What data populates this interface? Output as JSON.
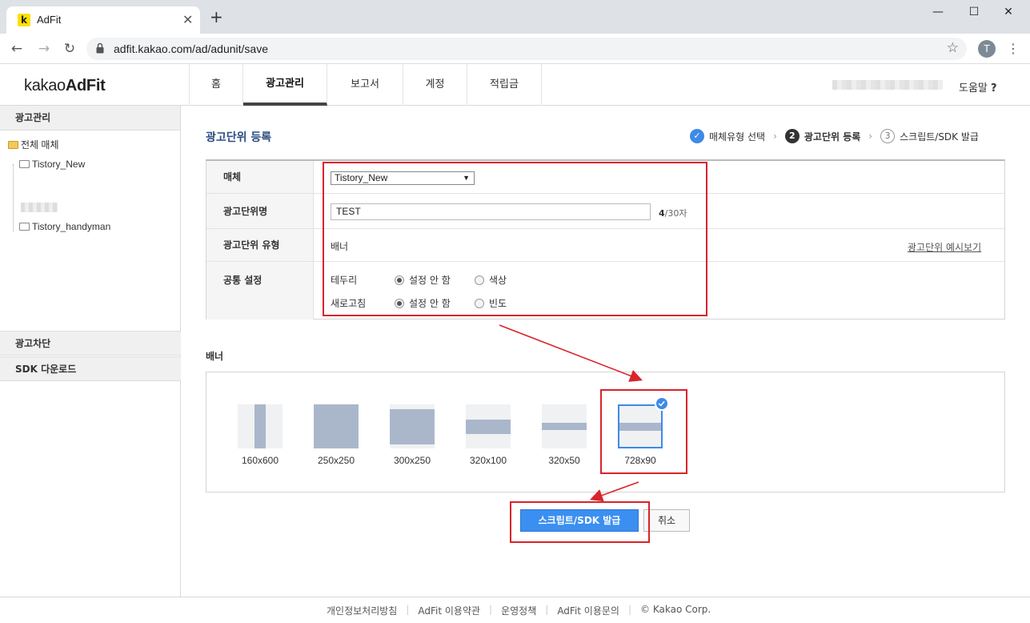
{
  "browser": {
    "tab_title": "AdFit",
    "favicon_letter": "k",
    "url": "adfit.kakao.com/ad/adunit/save",
    "profile_initial": "T",
    "icons": [
      "close-icon",
      "plus-icon",
      "back-icon",
      "forward-icon",
      "reload-icon",
      "lock-icon",
      "star-icon",
      "menu-icon",
      "minimize-icon",
      "maximize-icon"
    ]
  },
  "header": {
    "logo_light": "kakao",
    "logo_bold": "AdFit",
    "nav": [
      {
        "label": "홈"
      },
      {
        "label": "광고관리",
        "active": true
      },
      {
        "label": "보고서"
      },
      {
        "label": "계정"
      },
      {
        "label": "적립금"
      }
    ],
    "help_label": "도움말",
    "help_mark": "?"
  },
  "sidebar": {
    "title": "광고관리",
    "tree_root": "전체 매체",
    "tree_items": [
      "Tistory_New",
      "Tistory_handyman"
    ],
    "sections": [
      "광고차단",
      "SDK 다운로드"
    ]
  },
  "main": {
    "page_title": "광고단위 등록",
    "steps": [
      {
        "num": "✓",
        "label": "매체유형 선택",
        "state": "done"
      },
      {
        "num": "2",
        "label": "광고단위 등록",
        "state": "current"
      },
      {
        "num": "3",
        "label": "스크립트/SDK 발급",
        "state": "next"
      }
    ],
    "form": {
      "media_label": "매체",
      "media_value": "Tistory_New",
      "name_label": "광고단위명",
      "name_value": "TEST",
      "name_count": "4",
      "name_max": "/30자",
      "type_label": "광고단위 유형",
      "type_value": "배너",
      "preview_link": "광고단위 예시보기",
      "common_label": "공통 설정",
      "border_label": "테두리",
      "border_options": [
        "설정 안 함",
        "색상"
      ],
      "refresh_label": "새로고침",
      "refresh_options": [
        "설정 안 함",
        "빈도"
      ]
    },
    "banner_title": "배너",
    "banner_sizes": [
      "160x600",
      "250x250",
      "300x250",
      "320x100",
      "320x50",
      "728x90"
    ],
    "selected_banner": "728x90",
    "submit_label": "스크립트/SDK 발급",
    "cancel_label": "취소"
  },
  "footer": {
    "links": [
      "개인정보처리방침",
      "AdFit 이용약관",
      "운영정책",
      "AdFit 이용문의",
      "© Kakao Corp."
    ]
  },
  "colors": {
    "accent": "#3b8ff0",
    "annotation_red": "#d9232b",
    "title_blue": "#2d4c80",
    "thumb_fill": "#aab7cb"
  }
}
